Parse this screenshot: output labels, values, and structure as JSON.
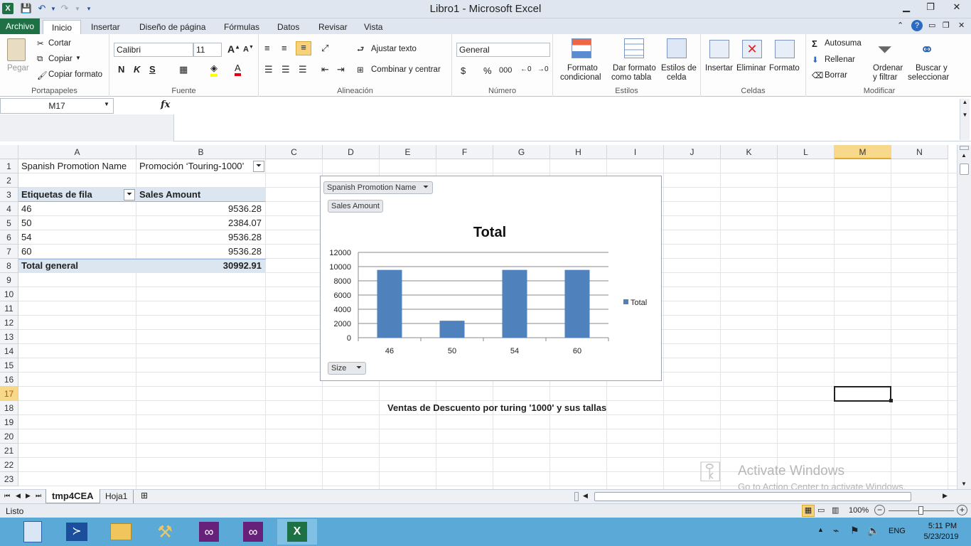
{
  "window": {
    "title": "Libro1  -  Microsoft Excel"
  },
  "tabs": {
    "archivo": "Archivo",
    "inicio": "Inicio",
    "insertar": "Insertar",
    "diseno": "Diseño de página",
    "formulas": "Fórmulas",
    "datos": "Datos",
    "revisar": "Revisar",
    "vista": "Vista"
  },
  "ribbon": {
    "clipboard": {
      "paste": "Pegar",
      "cut": "Cortar",
      "copy": "Copiar",
      "format_painter": "Copiar formato",
      "label": "Portapapeles"
    },
    "font": {
      "name": "Calibri",
      "size": "11",
      "bold": "N",
      "italic": "K",
      "underline": "S",
      "label": "Fuente"
    },
    "alignment": {
      "wrap": "Ajustar texto",
      "merge": "Combinar y centrar",
      "label": "Alineación"
    },
    "number": {
      "format": "General",
      "currency": "$",
      "percent": "%",
      "thousands": "000",
      "label": "Número"
    },
    "styles": {
      "cond": "Formato condicional",
      "cond1": "Formato",
      "cond2": "condicional",
      "table1": "Dar formato",
      "table2": "como tabla",
      "cell1": "Estilos de",
      "cell2": "celda",
      "label": "Estilos"
    },
    "cells": {
      "insert": "Insertar",
      "delete": "Eliminar",
      "format": "Formato",
      "label": "Celdas"
    },
    "editing": {
      "autosum": "Autosuma",
      "fill": "Rellenar",
      "clear": "Borrar",
      "sort1": "Ordenar",
      "sort2": "y filtrar",
      "find1": "Buscar y",
      "find2": "seleccionar",
      "label": "Modificar"
    }
  },
  "formula_bar": {
    "name_box": "M17",
    "fx": "fx",
    "value": ""
  },
  "columns": [
    "A",
    "B",
    "C",
    "D",
    "E",
    "F",
    "G",
    "H",
    "I",
    "J",
    "K",
    "L",
    "M",
    "N"
  ],
  "rows": [
    "1",
    "2",
    "3",
    "4",
    "5",
    "6",
    "7",
    "8",
    "9",
    "10",
    "11",
    "12",
    "13",
    "14",
    "15",
    "16",
    "17",
    "18",
    "19",
    "20",
    "21",
    "22",
    "23"
  ],
  "pivot": {
    "filter_label": "Spanish Promotion Name",
    "filter_value": "Promoción ‘Touring-1000’",
    "row_header": "Etiquetas de fila",
    "value_header": "Sales Amount",
    "rows": [
      {
        "label": "46",
        "value": "9536.28"
      },
      {
        "label": "50",
        "value": "2384.07"
      },
      {
        "label": "54",
        "value": "9536.28"
      },
      {
        "label": "60",
        "value": "9536.28"
      }
    ],
    "total_label": "Total general",
    "total_value": "30992.91"
  },
  "chart_buttons": {
    "filter": "Spanish Promotion Name",
    "values": "Sales Amount",
    "axis": "Size"
  },
  "chart_data": {
    "type": "bar",
    "title": "Total",
    "categories": [
      "46",
      "50",
      "54",
      "60"
    ],
    "series": [
      {
        "name": "Total",
        "values": [
          9536.28,
          2384.07,
          9536.28,
          9536.28
        ],
        "color": "#4f81bd"
      }
    ],
    "ylim": [
      0,
      12000
    ],
    "yticks": [
      "0",
      "2000",
      "4000",
      "6000",
      "8000",
      "10000",
      "12000"
    ],
    "legend": "right",
    "grid": true
  },
  "caption": "Ventas de Descuento por turing '1000' y sus tallas",
  "watermark": {
    "line1": "Activate Windows",
    "line2": "Go to Action Center to activate Windows."
  },
  "sheets": [
    "tmp4CEA",
    "Hoja1"
  ],
  "status": {
    "ready": "Listo",
    "zoom": "100%"
  },
  "taskbar": {
    "lang": "ENG",
    "time": "5:11 PM",
    "date": "5/23/2019"
  },
  "colors": {
    "excel_green": "#1e7145",
    "bar": "#4f81bd",
    "taskbar": "#5aa9d6",
    "selected_col": "#f8d98b"
  }
}
